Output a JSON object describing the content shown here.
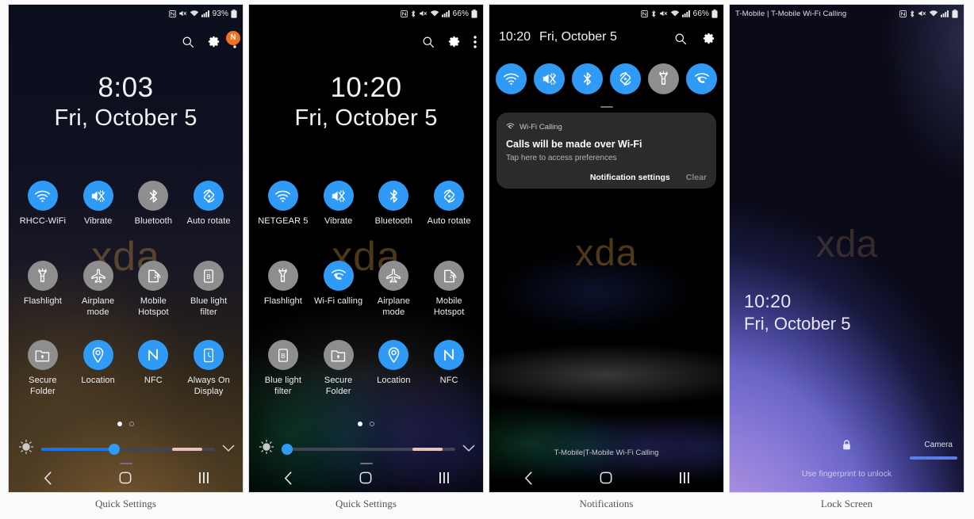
{
  "captions": [
    {
      "label": "Quick Settings"
    },
    {
      "label": "Quick Settings"
    },
    {
      "label": "Notifications"
    },
    {
      "label": "Lock Screen"
    }
  ],
  "colors": {
    "tile_on": "#2f9bf7",
    "tile_off": "#8e8e8e",
    "badge": "#f37121",
    "slider_fill": "#1a73e8",
    "slider_auto": "#e6c3bb"
  },
  "panel1": {
    "name": "quick-settings-page-1",
    "statusbar": {
      "icons": [
        "nfc-icon",
        "mute-icon",
        "wifi-icon",
        "signal-icon"
      ],
      "battery": "93%",
      "battery_icon": "battery-icon"
    },
    "header_icons": [
      "search-icon",
      "gear-icon",
      "more-options-icon"
    ],
    "badge": "N",
    "clock": {
      "time": "8:03",
      "date": "Fri, October 5"
    },
    "watermark": "xda",
    "tiles": [
      {
        "label": "RHCC-WiFi",
        "icon": "wifi-icon",
        "state": "on"
      },
      {
        "label": "Vibrate",
        "icon": "vibrate-icon",
        "state": "on"
      },
      {
        "label": "Bluetooth",
        "icon": "bluetooth-icon",
        "state": "off"
      },
      {
        "label": "Auto rotate",
        "icon": "auto-rotate-icon",
        "state": "on"
      },
      {
        "label": "Flashlight",
        "icon": "flashlight-icon",
        "state": "off"
      },
      {
        "label": "Airplane mode",
        "icon": "airplane-icon",
        "state": "off"
      },
      {
        "label": "Mobile Hotspot",
        "icon": "hotspot-icon",
        "state": "off"
      },
      {
        "label": "Blue light filter",
        "icon": "blue-light-filter-icon",
        "state": "off"
      },
      {
        "label": "Secure Folder",
        "icon": "secure-folder-icon",
        "state": "off"
      },
      {
        "label": "Location",
        "icon": "location-icon",
        "state": "on"
      },
      {
        "label": "NFC",
        "icon": "nfc-icon",
        "state": "on"
      },
      {
        "label": "Always On Display",
        "icon": "always-on-display-icon",
        "state": "on"
      }
    ],
    "pager": {
      "pages": 2,
      "active": 0
    },
    "brightness": {
      "value_pct": 42,
      "auto_marker_pct": 84
    },
    "navbar": [
      "back-button",
      "home-button",
      "recents-button"
    ]
  },
  "panel2": {
    "name": "quick-settings-page-2",
    "statusbar": {
      "icons": [
        "nfc-icon",
        "bluetooth-icon",
        "mute-icon",
        "wifi-icon",
        "signal-icon"
      ],
      "battery": "66%",
      "battery_icon": "battery-icon"
    },
    "header_icons": [
      "search-icon",
      "gear-icon",
      "more-options-icon"
    ],
    "clock": {
      "time": "10:20",
      "date": "Fri, October 5"
    },
    "watermark": "xda",
    "tiles": [
      {
        "label": "NETGEAR 5",
        "icon": "wifi-icon",
        "state": "on"
      },
      {
        "label": "Vibrate",
        "icon": "vibrate-icon",
        "state": "on"
      },
      {
        "label": "Bluetooth",
        "icon": "bluetooth-icon",
        "state": "on"
      },
      {
        "label": "Auto rotate",
        "icon": "auto-rotate-icon",
        "state": "on"
      },
      {
        "label": "Flashlight",
        "icon": "flashlight-icon",
        "state": "off"
      },
      {
        "label": "Wi-Fi calling",
        "icon": "wifi-calling-icon",
        "state": "on"
      },
      {
        "label": "Airplane mode",
        "icon": "airplane-icon",
        "state": "off"
      },
      {
        "label": "Mobile Hotspot",
        "icon": "hotspot-icon",
        "state": "off"
      },
      {
        "label": "Blue light filter",
        "icon": "blue-light-filter-icon",
        "state": "off"
      },
      {
        "label": "Secure Folder",
        "icon": "secure-folder-icon",
        "state": "off"
      },
      {
        "label": "Location",
        "icon": "location-icon",
        "state": "on"
      },
      {
        "label": "NFC",
        "icon": "nfc-icon",
        "state": "on"
      }
    ],
    "pager": {
      "pages": 2,
      "active": 0
    },
    "brightness": {
      "value_pct": 3,
      "auto_marker_pct": 84
    },
    "navbar": [
      "back-button",
      "home-button",
      "recents-button"
    ]
  },
  "panel3": {
    "name": "notification-shade",
    "statusbar": {
      "icons": [
        "nfc-icon",
        "bluetooth-icon",
        "mute-icon",
        "wifi-icon",
        "signal-icon"
      ],
      "battery": "66%",
      "battery_icon": "battery-icon"
    },
    "header": {
      "time": "10:20",
      "date": "Fri, October 5"
    },
    "header_icons": [
      "search-icon",
      "gear-icon"
    ],
    "tiles": [
      {
        "icon": "wifi-icon",
        "state": "on"
      },
      {
        "icon": "vibrate-icon",
        "state": "on"
      },
      {
        "icon": "bluetooth-icon",
        "state": "on"
      },
      {
        "icon": "auto-rotate-icon",
        "state": "on"
      },
      {
        "icon": "flashlight-icon",
        "state": "off"
      },
      {
        "icon": "wifi-calling-icon",
        "state": "on"
      }
    ],
    "notification": {
      "app_icon": "wifi-calling-icon",
      "app_name": "Wi-Fi Calling",
      "title": "Calls will be made over Wi-Fi",
      "subtitle": "Tap here to access preferences",
      "primary_action": "Notification settings",
      "secondary_action": "Clear"
    },
    "watermark": "xda",
    "carrier_footer": "T-Mobile|T-Mobile Wi-Fi Calling",
    "navbar": [
      "back-button",
      "home-button",
      "recents-button"
    ]
  },
  "panel4": {
    "name": "lock-screen",
    "statusbar": {
      "carrier": "T-Mobile | T-Mobile Wi-Fi Calling",
      "icons": [
        "nfc-icon",
        "bluetooth-icon",
        "mute-icon",
        "wifi-icon",
        "signal-icon"
      ],
      "battery_icon": "battery-icon"
    },
    "clock": {
      "time": "10:20",
      "date": "Fri, October 5"
    },
    "watermark": "xda",
    "lock_icon": "lock-icon",
    "hint": "Use fingerprint to unlock",
    "camera_label": "Camera"
  }
}
